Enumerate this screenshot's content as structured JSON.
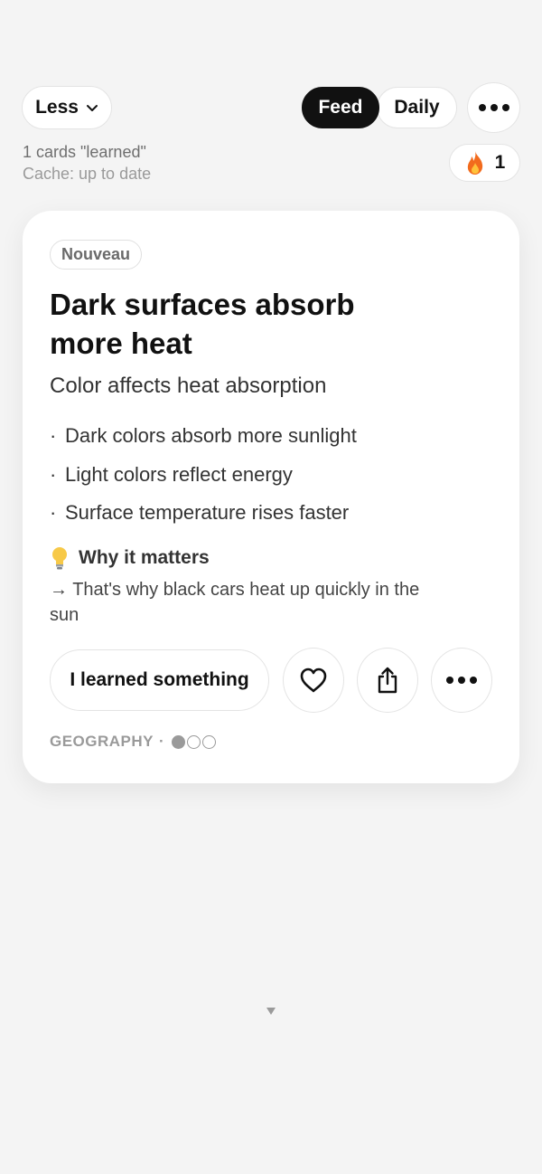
{
  "header": {
    "less_label": "Less",
    "tabs": [
      {
        "label": "Feed",
        "active": true
      },
      {
        "label": "Daily",
        "active": false
      }
    ],
    "more_icon": "ellipsis-icon"
  },
  "stats": {
    "learned_text": "1 cards \"learned\"",
    "cache_text": "Cache: up to date"
  },
  "streak": {
    "icon": "flame-icon",
    "count": "1"
  },
  "card": {
    "tag": "Nouveau",
    "title": "Dark surfaces absorb more heat",
    "subtitle": "Color affects heat absorption",
    "bullets": [
      "Dark colors absorb more sunlight",
      "Light colors reflect energy",
      "Surface temperature rises faster"
    ],
    "why_heading": "Why it matters",
    "why_text": "→ That's why black cars heat up quickly in the sun",
    "learned_button": "I learned something",
    "category": "GEOGRAPHY",
    "separator": "·",
    "progress": {
      "filled": 1,
      "total": 3
    }
  },
  "colors": {
    "accent": "#111111",
    "background": "#f4f4f4",
    "card": "#ffffff",
    "muted": "#9a9a9a",
    "flame": "#f26b1d",
    "bulb": "#f7c948"
  }
}
